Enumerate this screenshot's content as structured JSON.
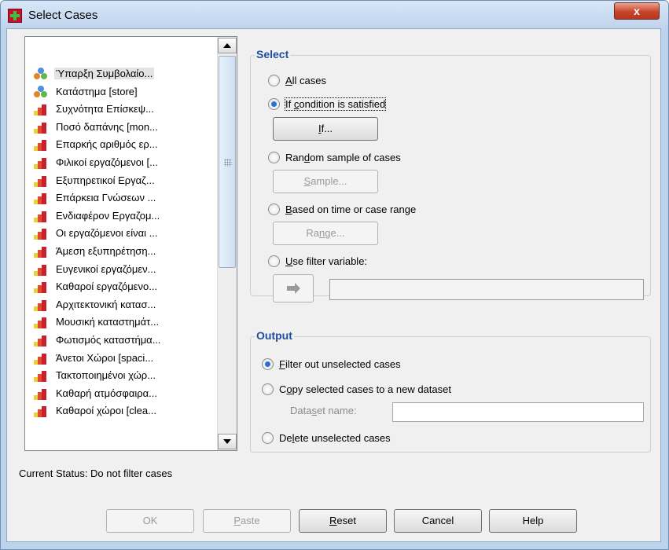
{
  "window": {
    "title": "Select Cases",
    "close_label": "x"
  },
  "variables": [
    {
      "label": "Ύπαρξη Συμβολαίο...",
      "icon": "nominal-icon",
      "selected": true
    },
    {
      "label": "Κατάστημα [store]",
      "icon": "nominal-icon"
    },
    {
      "label": "Συχνότητα Επίσκεψ...",
      "icon": "scale-icon"
    },
    {
      "label": "Ποσό δαπάνης [mon...",
      "icon": "scale-icon"
    },
    {
      "label": "Επαρκής αριθμός ερ...",
      "icon": "scale-icon"
    },
    {
      "label": "Φιλικοί εργαζόμενοι [...",
      "icon": "scale-icon"
    },
    {
      "label": "Εξυπηρετικοί Εργαζ...",
      "icon": "scale-icon"
    },
    {
      "label": "Επάρκεια Γνώσεων ...",
      "icon": "scale-icon"
    },
    {
      "label": "Ενδιαφέρον Εργαζομ...",
      "icon": "scale-icon"
    },
    {
      "label": "Οι εργαζόμενοι είναι ...",
      "icon": "scale-icon"
    },
    {
      "label": "Άμεση εξυπηρέτηση...",
      "icon": "scale-icon"
    },
    {
      "label": "Ευγενικοί εργαζόμεν...",
      "icon": "scale-icon"
    },
    {
      "label": "Καθαροί εργαζόμενο...",
      "icon": "scale-icon"
    },
    {
      "label": "Αρχιτεκτονική κατασ...",
      "icon": "scale-icon"
    },
    {
      "label": "Μουσική καταστημάτ...",
      "icon": "scale-icon"
    },
    {
      "label": "Φωτισμός καταστήμα...",
      "icon": "scale-icon"
    },
    {
      "label": "Άνετοι Χώροι [spaci...",
      "icon": "scale-icon"
    },
    {
      "label": "Τακτοποιημένοι χώρ...",
      "icon": "scale-icon"
    },
    {
      "label": "Καθαρή ατμόσφαιρα...",
      "icon": "scale-icon"
    },
    {
      "label": "Καθαροί χώροι [clea...",
      "icon": "scale-icon"
    }
  ],
  "select": {
    "label": "Select",
    "all_cases": {
      "pre": "",
      "mn": "A",
      "post": "ll cases"
    },
    "if_condition": {
      "pre": "If ",
      "mn": "c",
      "post": "ondition is satisfied"
    },
    "if_button": {
      "pre": "",
      "mn": "I",
      "post": "f..."
    },
    "random_sample": {
      "pre": "Ran",
      "mn": "d",
      "post": "om sample of cases"
    },
    "sample_button": {
      "pre": "",
      "mn": "S",
      "post": "ample..."
    },
    "time_range": {
      "pre": "",
      "mn": "B",
      "post": "ased on time or case range"
    },
    "range_button": {
      "pre": "Ra",
      "mn": "n",
      "post": "ge..."
    },
    "filter_variable": {
      "pre": "",
      "mn": "U",
      "post": "se filter variable:"
    }
  },
  "output": {
    "label": "Output",
    "filter_out": {
      "pre": "",
      "mn": "F",
      "post": "ilter out unselected cases"
    },
    "copy_to_dataset": {
      "pre": "C",
      "mn": "o",
      "post": "py selected cases to a new dataset"
    },
    "dataset_name": {
      "pre": "Data",
      "mn": "s",
      "post": "et name:"
    },
    "delete_unselected": {
      "pre": "De",
      "mn": "l",
      "post": "ete unselected cases"
    }
  },
  "status": "Current Status: Do not filter cases",
  "buttons": {
    "ok": {
      "pre": "OK",
      "mn": "",
      "post": ""
    },
    "paste": {
      "pre": "",
      "mn": "P",
      "post": "aste"
    },
    "reset": {
      "pre": "",
      "mn": "R",
      "post": "eset"
    },
    "cancel": {
      "pre": "Cancel",
      "mn": "",
      "post": ""
    },
    "help": {
      "pre": "Help",
      "mn": "",
      "post": ""
    }
  },
  "colors": {
    "accent": "#1f4f9c",
    "radio_dot": "#2a6fd1",
    "titlebar": "#bed3ec",
    "close": "#c8442a"
  }
}
